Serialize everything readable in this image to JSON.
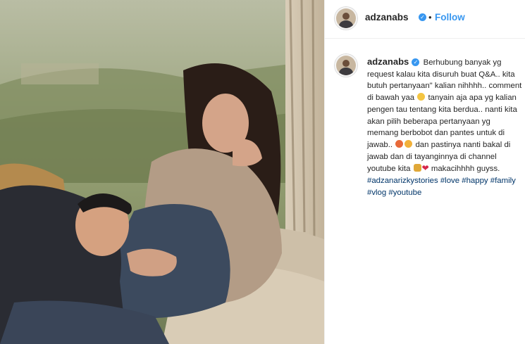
{
  "post": {
    "photo_alt": "couple on sofa",
    "header": {
      "username": "adzanabs",
      "separator": "•",
      "follow_label": "Follow"
    },
    "caption": {
      "username": "adzanabs",
      "segments": {
        "s1": "Berhubung banyak yg request kalau kita disuruh buat Q&A.. kita butuh pertanyaan\" kalian nihhhh.. comment di bawah yaa",
        "s2": "tanyain aja apa yg kalian pengen tau tentang kita berdua.. nanti kita akan pilih beberapa pertanyaan yg memang berbobot dan pantes untuk di jawab..",
        "s3": "dan pastinya nanti bakal di jawab dan di tayanginnya di channel youtube kita",
        "s4": "makacihhhh guyss."
      },
      "hashtags": [
        "#adzanarizkystories",
        "#love",
        "#happy",
        "#family",
        "#vlog",
        "#youtube"
      ]
    },
    "icons": [
      "verified-badge-icon",
      "smile-emoji-icon",
      "heart-eyes-emoji-icon",
      "kiss-emoji-icon",
      "couple-emoji-icon",
      "red-heart-emoji-icon"
    ],
    "colors": {
      "link": "#3897f0",
      "hashtag": "#003569",
      "text": "#262626"
    }
  }
}
